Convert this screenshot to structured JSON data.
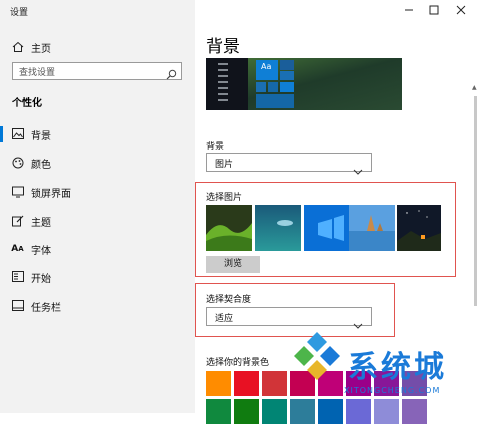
{
  "window": {
    "title": "设置"
  },
  "sidebar": {
    "home_label": "主页",
    "search_placeholder": "查找设置",
    "section": "个性化",
    "items": [
      {
        "label": "背景",
        "icon": "picture-icon",
        "active": true
      },
      {
        "label": "颜色",
        "icon": "palette-icon",
        "active": false
      },
      {
        "label": "锁屏界面",
        "icon": "monitor-icon",
        "active": false
      },
      {
        "label": "主题",
        "icon": "brush-icon",
        "active": false
      },
      {
        "label": "字体",
        "icon": "font-icon",
        "active": false
      },
      {
        "label": "开始",
        "icon": "start-icon",
        "active": false
      },
      {
        "label": "任务栏",
        "icon": "taskbar-icon",
        "active": false
      }
    ]
  },
  "main": {
    "title": "背景",
    "preview_tile_text": "Aa",
    "background_label": "背景",
    "background_value": "图片",
    "choose_picture_label": "选择图片",
    "browse_label": "浏览",
    "fit_label": "选择契合度",
    "fit_value": "适应",
    "bg_color_label": "选择你的背景色",
    "swatch_colors": [
      "#ff8c00",
      "#e81123",
      "#d13438",
      "#c30052",
      "#bf0077",
      "#9a0089",
      "#881798",
      "#744da9",
      "#10893e",
      "#107c10",
      "#018574",
      "#2d7d9a",
      "#0063b1",
      "#6b69d6",
      "#8e8cd8",
      "#8764b8"
    ]
  },
  "watermark": {
    "text": "系统城",
    "sub": "XITONGCHENG.COM"
  }
}
